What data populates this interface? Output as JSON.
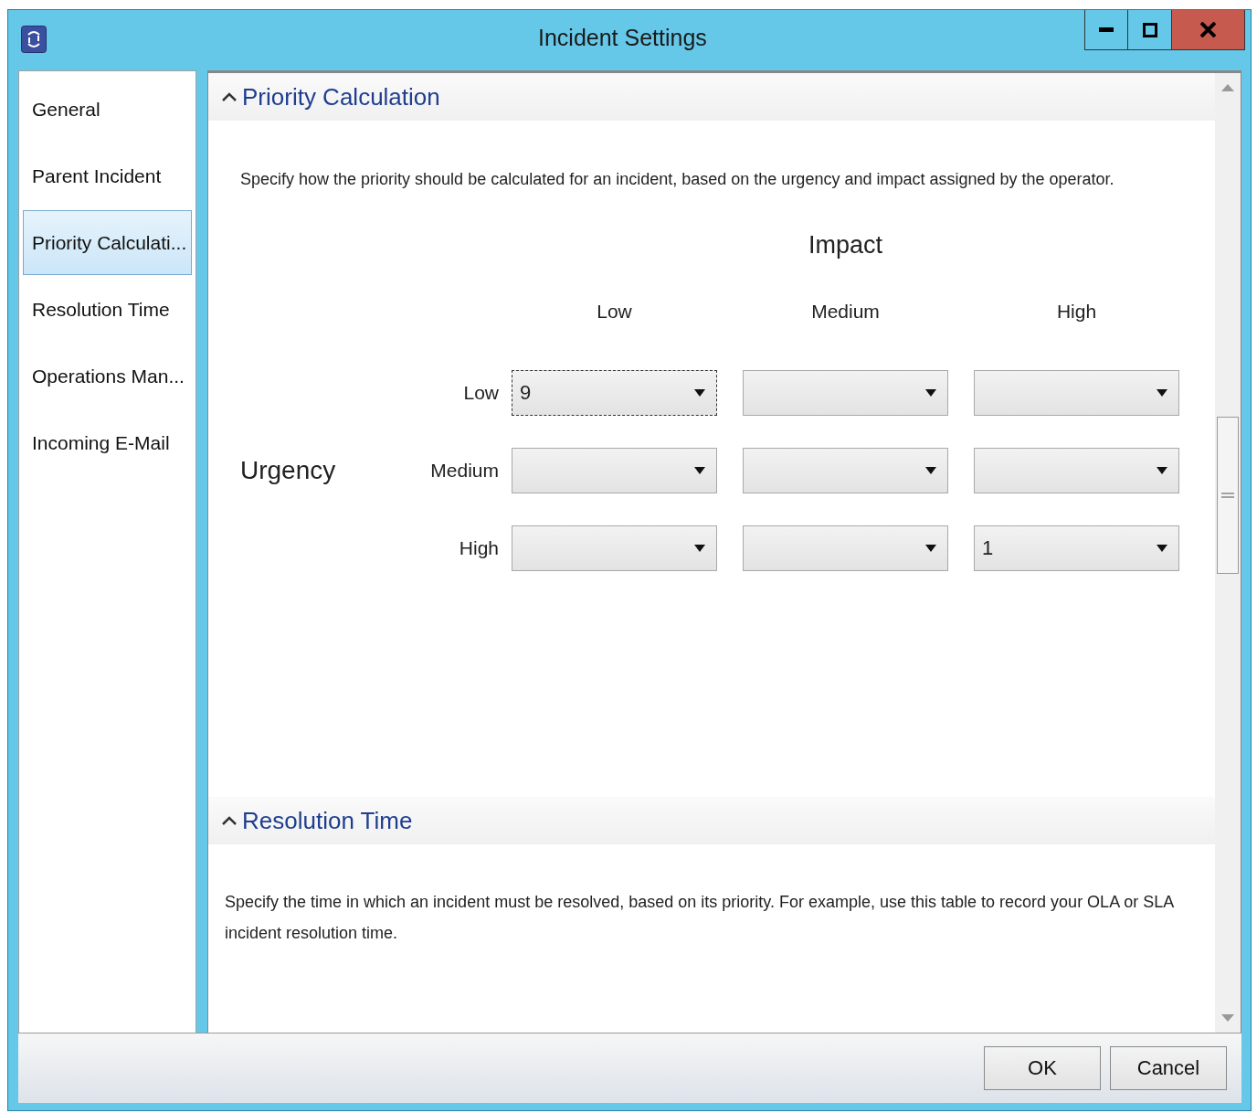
{
  "window": {
    "title": "Incident Settings"
  },
  "title_buttons": [
    {
      "kind": "minimize"
    },
    {
      "kind": "maximize"
    },
    {
      "kind": "close"
    }
  ],
  "sidebar": {
    "items": [
      {
        "label": "General",
        "selected": false
      },
      {
        "label": "Parent Incident",
        "selected": false
      },
      {
        "label": "Priority Calculati...",
        "selected": true
      },
      {
        "label": "Resolution Time",
        "selected": false
      },
      {
        "label": "Operations Man...",
        "selected": false
      },
      {
        "label": "Incoming E-Mail",
        "selected": false
      }
    ]
  },
  "sections": [
    {
      "title": "Priority Calculation",
      "expanded": true,
      "description": "Specify how the priority should be calculated for an incident, based on the urgency and impact assigned by the operator.",
      "matrix": {
        "column_header": "Impact",
        "row_header": "Urgency",
        "columns": [
          "Low",
          "Medium",
          "High"
        ],
        "rows": [
          {
            "label": "Low",
            "cells": [
              {
                "value": "9",
                "focused": true
              },
              {
                "focused": false
              },
              {
                "focused": false
              }
            ]
          },
          {
            "label": "Medium",
            "cells": [
              {
                "focused": false
              },
              {
                "focused": false
              },
              {
                "focused": false
              }
            ]
          },
          {
            "label": "High",
            "cells": [
              {
                "focused": false
              },
              {
                "focused": false
              },
              {
                "value": "1",
                "focused": false
              }
            ]
          }
        ]
      }
    },
    {
      "title": "Resolution Time",
      "expanded": true,
      "description": "Specify the time in which an incident must be resolved, based on its priority. For example, use this table to record your OLA or SLA incident resolution time."
    }
  ],
  "buttons": [
    "OK",
    "Cancel"
  ]
}
